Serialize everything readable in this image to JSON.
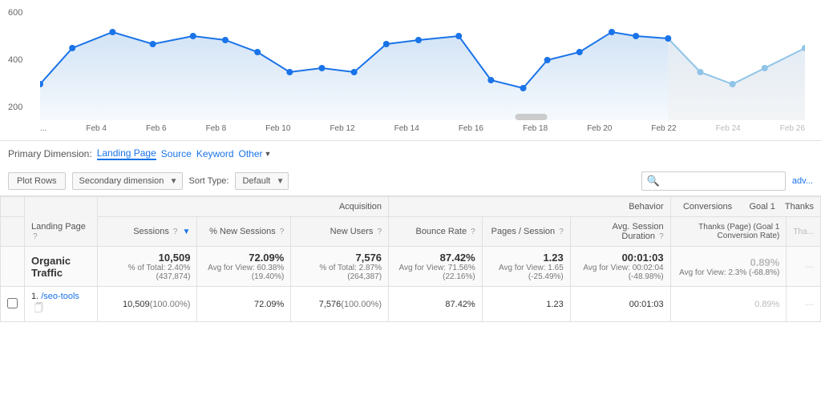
{
  "chart": {
    "y_labels": [
      "600",
      "400",
      "200"
    ],
    "x_labels": [
      "...",
      "Feb 4",
      "Feb 6",
      "Feb 8",
      "Feb 10",
      "Feb 12",
      "Feb 14",
      "Feb 16",
      "Feb 18",
      "Feb 20",
      "Feb 22",
      "Feb 24",
      "Feb 26"
    ]
  },
  "primary_dimension": {
    "label": "Primary Dimension:",
    "options": [
      "Landing Page",
      "Source",
      "Keyword",
      "Other"
    ]
  },
  "toolbar": {
    "plot_rows": "Plot Rows",
    "secondary_dimension": "Secondary dimension",
    "sort_type_label": "Sort Type:",
    "sort_default": "Default",
    "search_placeholder": ""
  },
  "table": {
    "col_groups": [
      {
        "id": "acquisition",
        "label": "Acquisition",
        "span": 3
      },
      {
        "id": "behavior",
        "label": "Behavior",
        "span": 3
      },
      {
        "id": "conversions",
        "label": "Conversions",
        "span": 2
      }
    ],
    "headers": [
      {
        "id": "landing-page",
        "label": "Landing Page",
        "help": true,
        "left": true
      },
      {
        "id": "sessions",
        "label": "Sessions",
        "help": true,
        "sort": true
      },
      {
        "id": "pct-new-sessions",
        "label": "% New Sessions",
        "help": true
      },
      {
        "id": "new-users",
        "label": "New Users",
        "help": true
      },
      {
        "id": "bounce-rate",
        "label": "Bounce Rate",
        "help": true
      },
      {
        "id": "pages-session",
        "label": "Pages / Session",
        "help": true
      },
      {
        "id": "avg-session-duration",
        "label": "Avg. Session Duration",
        "help": true
      },
      {
        "id": "thanks-goal1",
        "label": "Thanks (Page) (Goal 1 Conversion Rate)",
        "help": false
      },
      {
        "id": "thanks-value",
        "label": "Thanks",
        "help": false
      }
    ],
    "organic_row": {
      "label": "Organic Traffic",
      "sessions": "10,509",
      "sessions_sub": "% of Total: 2.40% (437,874)",
      "pct_new_sessions": "72.09%",
      "pct_new_sessions_sub": "Avg for View: 60.38% (19.40%)",
      "new_users": "7,576",
      "new_users_sub": "% of Total: 2.87% (264,387)",
      "bounce_rate": "87.42%",
      "bounce_rate_sub": "Avg for View: 71.56% (22.16%)",
      "pages_session": "1.23",
      "pages_session_sub": "Avg for View: 1.65 (-25.49%)",
      "avg_session_duration": "00:01:03",
      "avg_session_duration_sub": "Avg for View: 00:02:04 (-48.98%)",
      "thanks_goal1": "0.89%",
      "thanks_goal1_sub": "Avg for View: 2.3% (-68.8%)"
    },
    "rows": [
      {
        "num": "1.",
        "page": "/seo-tools",
        "sessions": "10,509",
        "sessions_pct": "(100.00%)",
        "pct_new_sessions": "72.09%",
        "new_users": "7,576",
        "new_users_pct": "(100.00%)",
        "bounce_rate": "87.42%",
        "pages_session": "1.23",
        "avg_session_duration": "00:01:03",
        "thanks_goal1": "0.89%"
      }
    ]
  }
}
